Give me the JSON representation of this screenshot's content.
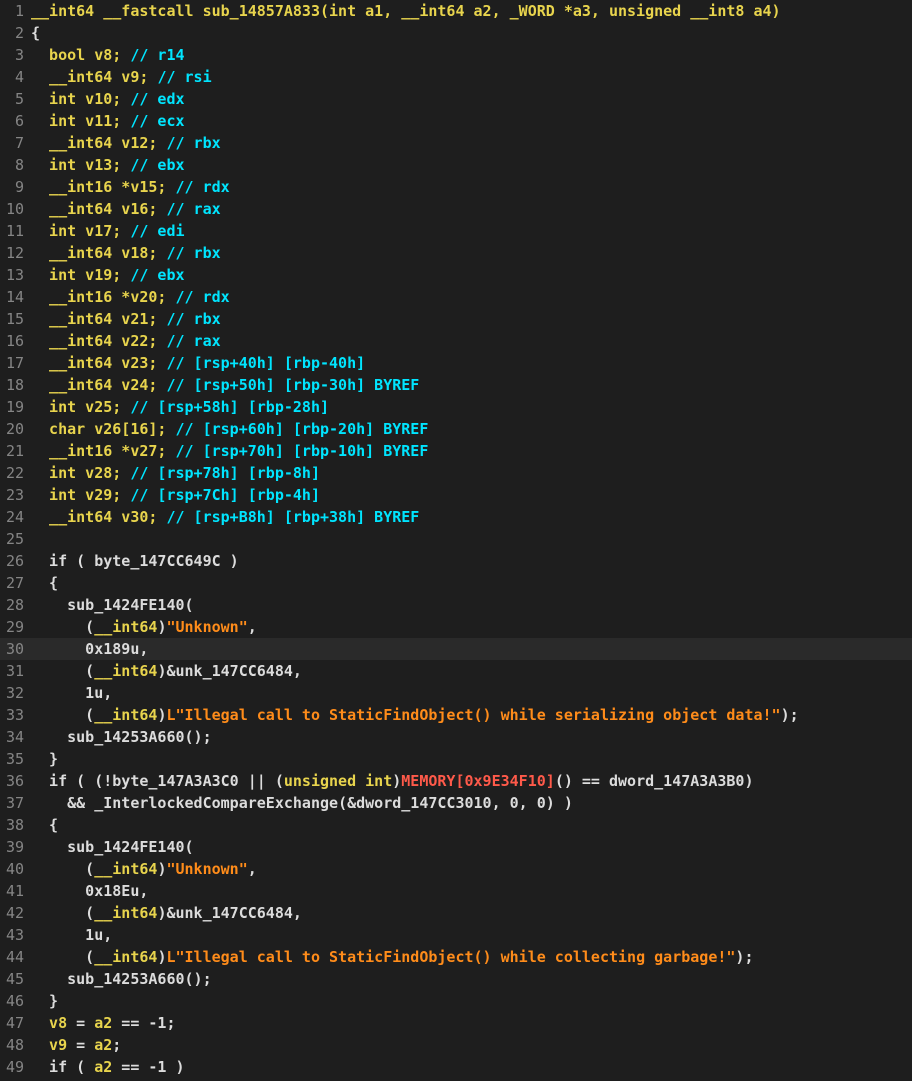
{
  "colors": {
    "background": "#1e1e1e",
    "line_highlight": "#2a2a2a",
    "line_number": "#858585",
    "default_text": "#dcdcdc",
    "type_keyword": "#e8d44d",
    "comment": "#00e5ff",
    "string": "#ff8c1a",
    "memory": "#ff5a4a"
  },
  "highlighted_line": 30,
  "lines": [
    {
      "n": "1",
      "t": [
        [
          "ty",
          "__int64 __fastcall sub_14857A833(int a1, __int64 a2, _WORD *a3, unsigned __int8 a4)"
        ]
      ]
    },
    {
      "n": "2",
      "t": [
        [
          "pun",
          "{"
        ]
      ]
    },
    {
      "n": "3",
      "t": [
        [
          "ty",
          "  bool v8; "
        ],
        [
          "cm",
          "// r14"
        ]
      ]
    },
    {
      "n": "4",
      "t": [
        [
          "ty",
          "  __int64 v9; "
        ],
        [
          "cm",
          "// rsi"
        ]
      ]
    },
    {
      "n": "5",
      "t": [
        [
          "ty",
          "  int v10; "
        ],
        [
          "cm",
          "// edx"
        ]
      ]
    },
    {
      "n": "6",
      "t": [
        [
          "ty",
          "  int v11; "
        ],
        [
          "cm",
          "// ecx"
        ]
      ]
    },
    {
      "n": "7",
      "t": [
        [
          "ty",
          "  __int64 v12; "
        ],
        [
          "cm",
          "// rbx"
        ]
      ]
    },
    {
      "n": "8",
      "t": [
        [
          "ty",
          "  int v13; "
        ],
        [
          "cm",
          "// ebx"
        ]
      ]
    },
    {
      "n": "9",
      "t": [
        [
          "ty",
          "  __int16 *v15; "
        ],
        [
          "cm",
          "// rdx"
        ]
      ]
    },
    {
      "n": "10",
      "t": [
        [
          "ty",
          "  __int64 v16; "
        ],
        [
          "cm",
          "// rax"
        ]
      ]
    },
    {
      "n": "11",
      "t": [
        [
          "ty",
          "  int v17; "
        ],
        [
          "cm",
          "// edi"
        ]
      ]
    },
    {
      "n": "12",
      "t": [
        [
          "ty",
          "  __int64 v18; "
        ],
        [
          "cm",
          "// rbx"
        ]
      ]
    },
    {
      "n": "13",
      "t": [
        [
          "ty",
          "  int v19; "
        ],
        [
          "cm",
          "// ebx"
        ]
      ]
    },
    {
      "n": "14",
      "t": [
        [
          "ty",
          "  __int16 *v20; "
        ],
        [
          "cm",
          "// rdx"
        ]
      ]
    },
    {
      "n": "15",
      "t": [
        [
          "ty",
          "  __int64 v21; "
        ],
        [
          "cm",
          "// rbx"
        ]
      ]
    },
    {
      "n": "16",
      "t": [
        [
          "ty",
          "  __int64 v22; "
        ],
        [
          "cm",
          "// rax"
        ]
      ]
    },
    {
      "n": "17",
      "t": [
        [
          "ty",
          "  __int64 v23; "
        ],
        [
          "cm",
          "// [rsp+40h] [rbp-40h]"
        ]
      ]
    },
    {
      "n": "18",
      "t": [
        [
          "ty",
          "  __int64 v24; "
        ],
        [
          "cm",
          "// [rsp+50h] [rbp-30h] BYREF"
        ]
      ]
    },
    {
      "n": "19",
      "t": [
        [
          "ty",
          "  int v25; "
        ],
        [
          "cm",
          "// [rsp+58h] [rbp-28h]"
        ]
      ]
    },
    {
      "n": "20",
      "t": [
        [
          "ty",
          "  char v26[16]; "
        ],
        [
          "cm",
          "// [rsp+60h] [rbp-20h] BYREF"
        ]
      ]
    },
    {
      "n": "21",
      "t": [
        [
          "ty",
          "  __int16 *v27; "
        ],
        [
          "cm",
          "// [rsp+70h] [rbp-10h] BYREF"
        ]
      ]
    },
    {
      "n": "22",
      "t": [
        [
          "ty",
          "  int v28; "
        ],
        [
          "cm",
          "// [rsp+78h] [rbp-8h]"
        ]
      ]
    },
    {
      "n": "23",
      "t": [
        [
          "ty",
          "  int v29; "
        ],
        [
          "cm",
          "// [rsp+7Ch] [rbp-4h]"
        ]
      ]
    },
    {
      "n": "24",
      "t": [
        [
          "ty",
          "  __int64 v30; "
        ],
        [
          "cm",
          "// [rsp+B8h] [rbp+38h] BYREF"
        ]
      ]
    },
    {
      "n": "25",
      "t": [
        [
          "pun",
          ""
        ]
      ]
    },
    {
      "n": "26",
      "t": [
        [
          "kw",
          "  if ( "
        ],
        [
          "glb",
          "byte_147CC649C"
        ],
        [
          "pun",
          " )"
        ]
      ]
    },
    {
      "n": "27",
      "t": [
        [
          "pun",
          "  {"
        ]
      ]
    },
    {
      "n": "28",
      "t": [
        [
          "id",
          "    sub_1424FE140("
        ]
      ]
    },
    {
      "n": "29",
      "t": [
        [
          "pun",
          "      ("
        ],
        [
          "ty",
          "__int64"
        ],
        [
          "pun",
          ")"
        ],
        [
          "str",
          "\"Unknown\""
        ],
        [
          "pun",
          ","
        ]
      ]
    },
    {
      "n": "30",
      "t": [
        [
          "num",
          "      0x189u,"
        ]
      ]
    },
    {
      "n": "31",
      "t": [
        [
          "pun",
          "      ("
        ],
        [
          "ty",
          "__int64"
        ],
        [
          "pun",
          ")&"
        ],
        [
          "glb",
          "unk_147CC6484"
        ],
        [
          "pun",
          ","
        ]
      ]
    },
    {
      "n": "32",
      "t": [
        [
          "num",
          "      1u,"
        ]
      ]
    },
    {
      "n": "33",
      "t": [
        [
          "pun",
          "      ("
        ],
        [
          "ty",
          "__int64"
        ],
        [
          "pun",
          ")"
        ],
        [
          "str",
          "L\"Illegal call to StaticFindObject() while serializing object data!\""
        ],
        [
          "pun",
          ");"
        ]
      ]
    },
    {
      "n": "34",
      "t": [
        [
          "id",
          "    sub_14253A660();"
        ]
      ]
    },
    {
      "n": "35",
      "t": [
        [
          "pun",
          "  }"
        ]
      ]
    },
    {
      "n": "36",
      "t": [
        [
          "kw",
          "  if ( (!"
        ],
        [
          "glb",
          "byte_147A3A3C0"
        ],
        [
          "pun",
          " || ("
        ],
        [
          "ty",
          "unsigned int"
        ],
        [
          "pun",
          ")"
        ],
        [
          "mem",
          "MEMORY[0x9E34F10]"
        ],
        [
          "pun",
          "() == "
        ],
        [
          "glb",
          "dword_147A3A3B0"
        ],
        [
          "pun",
          ")"
        ]
      ]
    },
    {
      "n": "37",
      "t": [
        [
          "pun",
          "    && "
        ],
        [
          "id",
          "_InterlockedCompareExchange"
        ],
        [
          "pun",
          "(&"
        ],
        [
          "glb",
          "dword_147CC3010"
        ],
        [
          "pun",
          ", 0, 0) )"
        ]
      ]
    },
    {
      "n": "38",
      "t": [
        [
          "pun",
          "  {"
        ]
      ]
    },
    {
      "n": "39",
      "t": [
        [
          "id",
          "    sub_1424FE140("
        ]
      ]
    },
    {
      "n": "40",
      "t": [
        [
          "pun",
          "      ("
        ],
        [
          "ty",
          "__int64"
        ],
        [
          "pun",
          ")"
        ],
        [
          "str",
          "\"Unknown\""
        ],
        [
          "pun",
          ","
        ]
      ]
    },
    {
      "n": "41",
      "t": [
        [
          "num",
          "      0x18Eu,"
        ]
      ]
    },
    {
      "n": "42",
      "t": [
        [
          "pun",
          "      ("
        ],
        [
          "ty",
          "__int64"
        ],
        [
          "pun",
          ")&"
        ],
        [
          "glb",
          "unk_147CC6484"
        ],
        [
          "pun",
          ","
        ]
      ]
    },
    {
      "n": "43",
      "t": [
        [
          "num",
          "      1u,"
        ]
      ]
    },
    {
      "n": "44",
      "t": [
        [
          "pun",
          "      ("
        ],
        [
          "ty",
          "__int64"
        ],
        [
          "pun",
          ")"
        ],
        [
          "str",
          "L\"Illegal call to StaticFindObject() while collecting garbage!\""
        ],
        [
          "pun",
          ");"
        ]
      ]
    },
    {
      "n": "45",
      "t": [
        [
          "id",
          "    sub_14253A660();"
        ]
      ]
    },
    {
      "n": "46",
      "t": [
        [
          "pun",
          "  }"
        ]
      ]
    },
    {
      "n": "47",
      "t": [
        [
          "ty",
          "  v8"
        ],
        [
          "pun",
          " = "
        ],
        [
          "ty",
          "a2"
        ],
        [
          "pun",
          " == -1;"
        ]
      ]
    },
    {
      "n": "48",
      "t": [
        [
          "ty",
          "  v9"
        ],
        [
          "pun",
          " = "
        ],
        [
          "ty",
          "a2"
        ],
        [
          "pun",
          ";"
        ]
      ]
    },
    {
      "n": "49",
      "t": [
        [
          "kw",
          "  if ( "
        ],
        [
          "ty",
          "a2"
        ],
        [
          "pun",
          " == -1 )"
        ]
      ]
    }
  ]
}
